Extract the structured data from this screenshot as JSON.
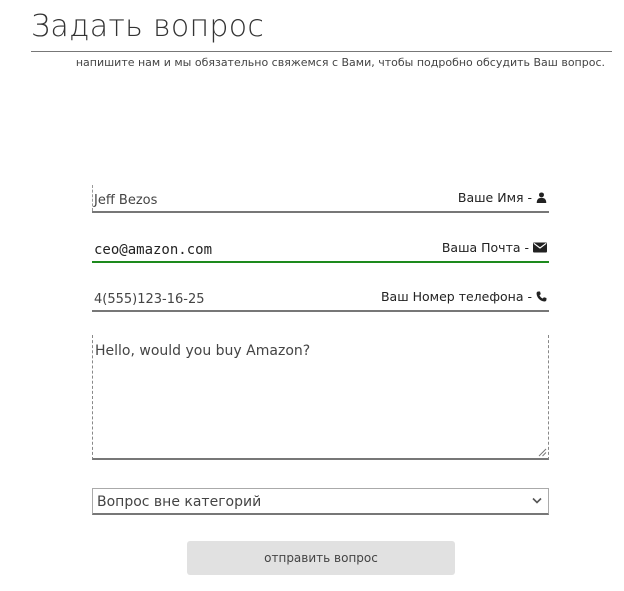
{
  "header": {
    "title": "Задать вопрос",
    "subtitle": "напишите нам и мы обязательно свяжемся с Вами, чтобы подробно обсудить Ваш вопрос."
  },
  "form": {
    "name": {
      "value": "Jeff Bezos",
      "label": "Ваше Имя -",
      "icon": "user-icon"
    },
    "email": {
      "value": "ceo@amazon.com",
      "label": "Ваша Почта -",
      "icon": "envelope-icon"
    },
    "phone": {
      "value": "4(555)123-16-25",
      "label": "Ваш Номер телефона -",
      "icon": "phone-icon"
    },
    "message": {
      "value": "Hello, would you buy Amazon?"
    },
    "category": {
      "selected": "Вопрос вне категорий"
    },
    "submit_label": "отправить вопрос"
  },
  "colors": {
    "active_underline": "#1d8a1d",
    "button_bg": "#e1e1e1"
  }
}
